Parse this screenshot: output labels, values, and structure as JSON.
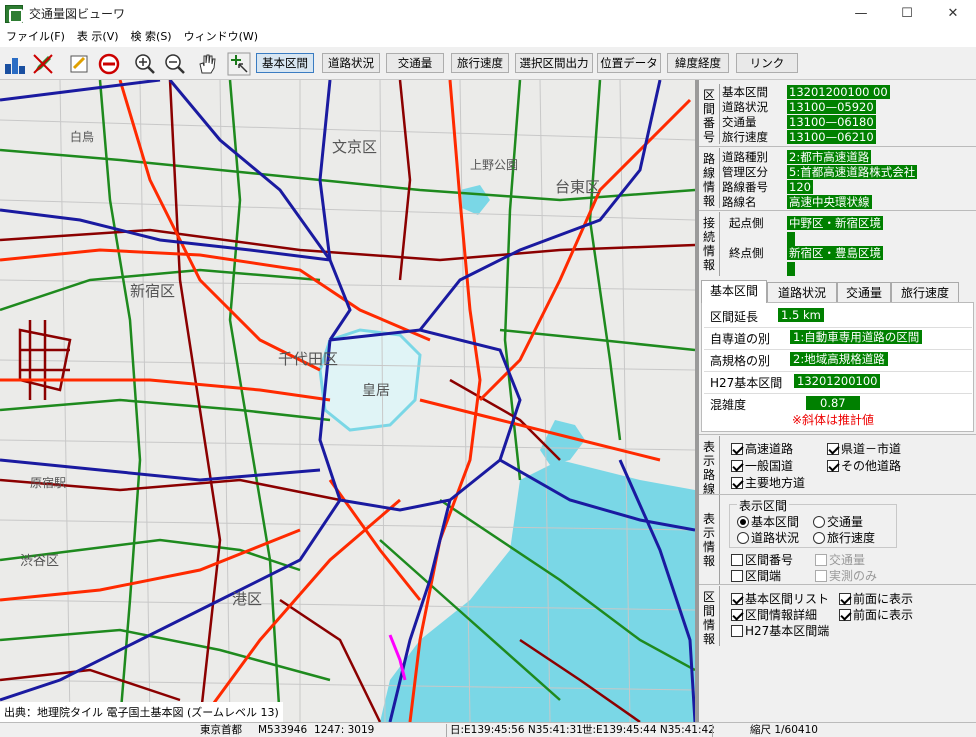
{
  "window": {
    "title": "交通量図ビューワ",
    "minimize": "—",
    "maximize": "☐",
    "close": "✕"
  },
  "menu": [
    "ファイル(F)",
    "表 示(V)",
    "検 索(S)",
    "ウィンドウ(W)"
  ],
  "toolbar": {
    "icons": [
      "layers-icon",
      "edit-pen-icon",
      "note-icon",
      "stop-icon",
      "zoom-in-icon",
      "zoom-out-icon",
      "hand-pan-icon",
      "select-cursor-icon"
    ],
    "buttons": [
      "基本区間",
      "道路状況",
      "交通量",
      "旅行速度",
      "選択区間出力",
      "位置データ",
      "緯度経度",
      "リンク"
    ],
    "active": "基本区間"
  },
  "map": {
    "labels": [
      "文京区",
      "新宿区",
      "千代田区",
      "港区",
      "皇居",
      "原宿駅",
      "渋谷区",
      "白鳥",
      "上野公園",
      "台東区"
    ],
    "attribution": "出典：地理院タイル 電子国土基本図 (ズームレベル 13)"
  },
  "section_number": {
    "heading": "区間番号",
    "rows": [
      {
        "label": "基本区間",
        "value": "13201200100",
        "extra": "00"
      },
      {
        "label": "道路状況",
        "value": "13100—05920"
      },
      {
        "label": "交通量",
        "value": "13100—06180"
      },
      {
        "label": "旅行速度",
        "value": "13100—06210"
      }
    ]
  },
  "route_info": {
    "heading": "路線情報",
    "rows": [
      {
        "label": "道路種別",
        "value": "2:都市高速道路"
      },
      {
        "label": "管理区分",
        "value": "5:首都高速道路株式会社"
      },
      {
        "label": "路線番号",
        "value": "120"
      },
      {
        "label": "路線名",
        "value": "高速中央環状線"
      }
    ]
  },
  "connection_info": {
    "heading": "接続情報",
    "start_label": "起点側",
    "start_value": "中野区・新宿区境",
    "end_label": "終点側",
    "end_value": "新宿区・豊島区境"
  },
  "tabs": [
    "基本区間",
    "道路状況",
    "交通量",
    "旅行速度"
  ],
  "tab_content": {
    "length_label": "区間延長",
    "length_value": "1.5 km",
    "road_type_label": "自専道の別",
    "road_type_value": "1:自動車専用道路の区間",
    "standard_label": "高規格の別",
    "standard_value": "2:地域高規格道路",
    "h27_label": "H27基本区間",
    "h27_value": "13201200100",
    "congestion_label": "混雑度",
    "congestion_value": "0.87",
    "note": "※斜体は推計値"
  },
  "display_roads": {
    "heading": "表示路線",
    "items": [
      {
        "label": "高速道路",
        "checked": true
      },
      {
        "label": "県道－市道",
        "checked": true
      },
      {
        "label": "一般国道",
        "checked": true
      },
      {
        "label": "その他道路",
        "checked": true
      },
      {
        "label": "主要地方道",
        "checked": true
      }
    ]
  },
  "display_info": {
    "heading": "表示情報",
    "group_title": "表示区間",
    "radios": [
      {
        "label": "基本区間",
        "selected": true
      },
      {
        "label": "交通量",
        "selected": false
      },
      {
        "label": "道路状況",
        "selected": false
      },
      {
        "label": "旅行速度",
        "selected": false
      }
    ],
    "checks": [
      {
        "label": "区間番号",
        "checked": false,
        "enabled": true
      },
      {
        "label": "交通量",
        "checked": false,
        "enabled": false
      },
      {
        "label": "区間端",
        "checked": false,
        "enabled": true
      },
      {
        "label": "実測のみ",
        "checked": false,
        "enabled": false
      }
    ]
  },
  "section_info": {
    "heading": "区間情報",
    "items": [
      {
        "label": "基本区間リスト",
        "checked": true
      },
      {
        "label": "前面に表示",
        "checked": true
      },
      {
        "label": "区間情報詳細",
        "checked": true
      },
      {
        "label": "前面に表示",
        "checked": true
      },
      {
        "label": "H27基本区間端",
        "checked": false
      }
    ]
  },
  "status": {
    "area": "東京首都",
    "mesh": "M533946",
    "coord": "1247: 3019",
    "jp_coord": "日:E139:45:56 N35:41:31",
    "world_coord": "世:E139:45:44 N35:41:42",
    "scale": "縮尺 1/60410"
  },
  "colors": {
    "expressway": "#1a1aa0",
    "national": "#ff2a00",
    "prefectural": "#1e8a1e",
    "other": "#8b0000",
    "water": "#7ad7e6",
    "highlight": "#008000"
  }
}
